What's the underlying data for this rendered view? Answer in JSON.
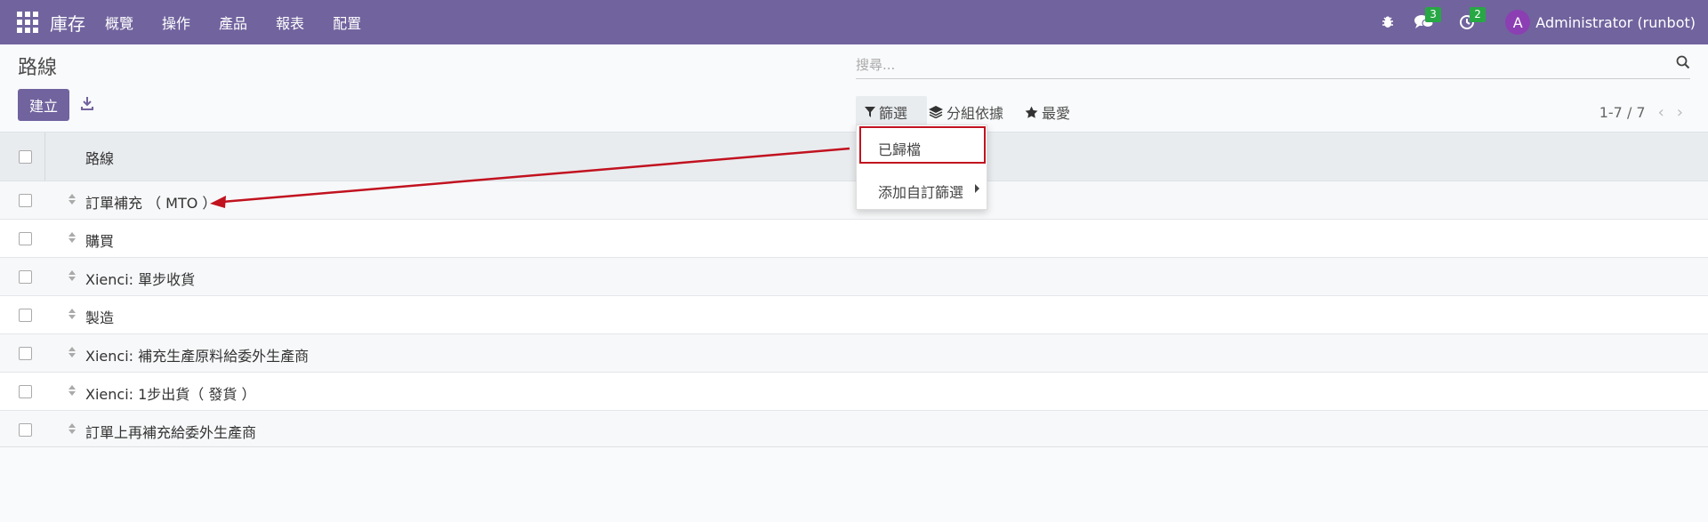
{
  "navbar": {
    "brand": "庫存",
    "menu": [
      "概覽",
      "操作",
      "產品",
      "報表",
      "配置"
    ],
    "messages_count": "3",
    "activities_count": "2",
    "avatar_letter": "A",
    "user_name": "Administrator (runbot)"
  },
  "control_panel": {
    "breadcrumb": "路線",
    "create_label": "建立",
    "search_placeholder": "搜尋...",
    "filter_label": "篩選",
    "groupby_label": "分組依據",
    "favorites_label": "最愛",
    "pager": "1-7 / 7"
  },
  "filter_dropdown": {
    "archived": "已歸檔",
    "custom_filter": "添加自訂篩選"
  },
  "table": {
    "header": "路線",
    "rows": [
      "訂單補充 （ MTO ）",
      "購買",
      "Xienci: 單步收貨",
      "製造",
      "Xienci: 補充生產原料給委外生產商",
      "Xienci: 1步出貨（ 發貨 ）",
      "訂單上再補充給委外生產商"
    ]
  },
  "colors": {
    "primary": "#71639e",
    "highlight": "#c1121f",
    "badge": "#28a745"
  }
}
